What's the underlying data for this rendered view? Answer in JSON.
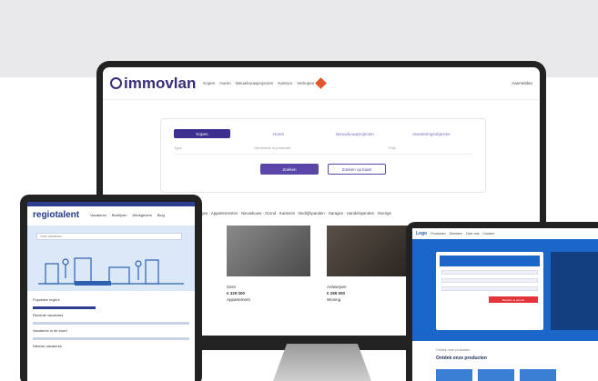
{
  "colors": {
    "band": "#e9e9ec",
    "immovlan_brand": "#3a2e7a",
    "immovlan_accent": "#5a46a8",
    "regiotalent_brand": "#233a8a",
    "laptop_brand": "#1b66c9",
    "laptop_cta": "#e2343a"
  },
  "desktop": {
    "logo": "immovlan",
    "nav_links": [
      "Kopen",
      "Huren",
      "Nieuwbouwprojecten",
      "Kantoor",
      "Verkopen"
    ],
    "account": "Aanmelden",
    "tabs": [
      "Kopen",
      "Huren",
      "Nieuwbouwprojecten",
      "Investeringsobjecten"
    ],
    "active_tab_index": 0,
    "fields": [
      "Type",
      "Gemeente of postcode",
      "Prijs"
    ],
    "search_button": "Zoeken",
    "map_button": "Zoeken op kaart",
    "category_strip": "Woningen · Appartementen · Nieuwbouw · Grond · Kantoren · Bedrijfspanden · Garages · Handelspanden · Overige",
    "listings": [
      {
        "title": "Gent",
        "price": "€ 329 000",
        "sub": "Appartement"
      },
      {
        "title": "Antwerpen",
        "price": "€ 289 000",
        "sub": "Woning"
      }
    ]
  },
  "tablet": {
    "logo": "regiotalent",
    "nav_links": [
      "Vacatures",
      "Bedrijven",
      "Werkgevers",
      "Blog"
    ],
    "search_placeholder": "Zoek vacatures",
    "section_title": "Populaire regio's",
    "lines": [
      "Recente vacatures",
      "Vacatures in de buurt",
      "Nieuwe vacatures"
    ]
  },
  "laptop": {
    "logo": "Logo",
    "nav_links": [
      "Producten",
      "Diensten",
      "Over ons",
      "Contact"
    ],
    "cta": "Bereken je premie",
    "subtitle": "Ontdek onze producten",
    "bottom_title": "Ontdek onze producten"
  }
}
